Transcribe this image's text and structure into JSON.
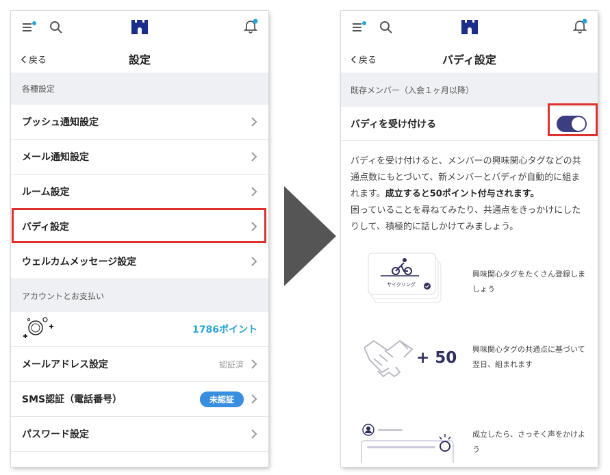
{
  "left": {
    "nav": {
      "back_label": "戻る",
      "title": "設定"
    },
    "section1": "各種設定",
    "items1": [
      {
        "label": "プッシュ通知設定"
      },
      {
        "label": "メール通知設定"
      },
      {
        "label": "ルーム設定"
      },
      {
        "label": "バディ設定"
      },
      {
        "label": "ウェルカムメッセージ設定"
      }
    ],
    "section2": "アカウントとお支払い",
    "points": "1786ポイント",
    "items2": [
      {
        "label": "メールアドレス設定",
        "status": "認証済"
      },
      {
        "label": "SMS認証（電話番号）",
        "badge": "未認証"
      },
      {
        "label": "パスワード設定"
      }
    ]
  },
  "right": {
    "nav": {
      "back_label": "戻る",
      "title": "バディ設定"
    },
    "section": "既存メンバー（入会１ヶ月以降）",
    "toggle": {
      "label": "バディを受け付ける",
      "on": true
    },
    "description": {
      "normal": "バディを受け付けると、メンバーの興味関心タグなどの共通点数にもとづいて、新メンバーとバディが自動的に組まれます。",
      "bold": "成立すると50ポイント付与されます。",
      "second": "困っていることを尋ねてみたり、共通点をきっかけにしたりして、積極的に話しかけてみましょう。"
    },
    "features": [
      {
        "card_tag": "サイクリング",
        "text": "興味関心タグをたくさん登録しましょう"
      },
      {
        "points_label": "+ 50",
        "text": "興味関心タグの共通点に基づいて翌日、組まれます"
      },
      {
        "text": "成立したら、さっそく声をかけよう"
      }
    ]
  },
  "colors": {
    "accent_blue": "#2aa4d6",
    "badge_blue": "#3a8ee0",
    "toggle_navy": "#3b3f82",
    "highlight_red": "#e0302d",
    "section_gray": "#eef0f3",
    "logo_navy": "#1b2f8a"
  },
  "icons": [
    "menu-icon",
    "search-icon",
    "logo-icon",
    "bell-icon",
    "chevron-left-icon",
    "chevron-right-icon",
    "avatar-icon",
    "cycling-icon",
    "handshake-icon",
    "person-icon",
    "sparkle-icon"
  ]
}
